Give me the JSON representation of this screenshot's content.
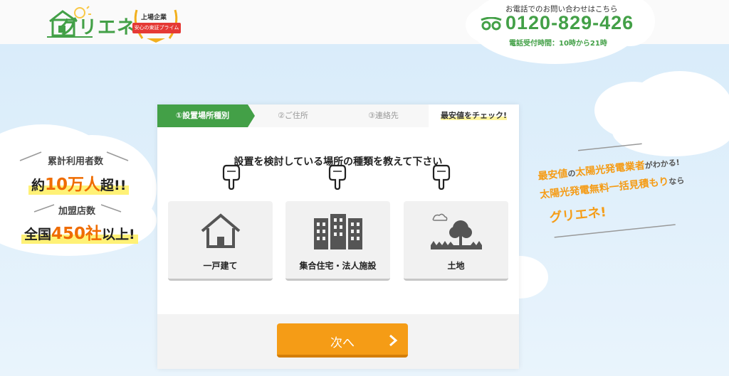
{
  "header": {
    "logo_text": "グリエネ",
    "badge_top": "上場企業",
    "badge_ribbon": "安心の東証プライム",
    "phone_note": "お電話でのお問い合わせはこちら",
    "phone_number": "0120-829-426",
    "phone_hours": "電話受付時間：10時から21時"
  },
  "stats": {
    "users_label": "累計利用者数",
    "users_prefix": "約",
    "users_num": "10万人",
    "users_suffix": "超!!",
    "stores_label": "加盟店数",
    "stores_prefix": "全国",
    "stores_num": "450社",
    "stores_suffix": "以上!"
  },
  "steps": [
    {
      "label": "①設置場所種別"
    },
    {
      "label": "②ご住所"
    },
    {
      "label": "③連絡先"
    },
    {
      "label": "最安値をチェック!"
    }
  ],
  "form": {
    "question": "設置を検討している場所の種類を教えて下さい",
    "options": [
      {
        "label": "一戸建て",
        "icon": "house-icon"
      },
      {
        "label": "集合住宅・法人施設",
        "icon": "building-icon"
      },
      {
        "label": "土地",
        "icon": "land-icon"
      }
    ],
    "next_label": "次へ"
  },
  "slogan": {
    "line1_a": "最安値",
    "line1_b": "の",
    "line1_c": "太陽光発電業者",
    "line1_d": "がわかる!",
    "line2_a": "太陽光発電無料一括見積もり",
    "line2_b": "なら",
    "line3": "グリエネ!"
  },
  "colors": {
    "brand_green": "#43a047",
    "accent_orange": "#f59c16",
    "highlight_yellow": "#fff176"
  }
}
